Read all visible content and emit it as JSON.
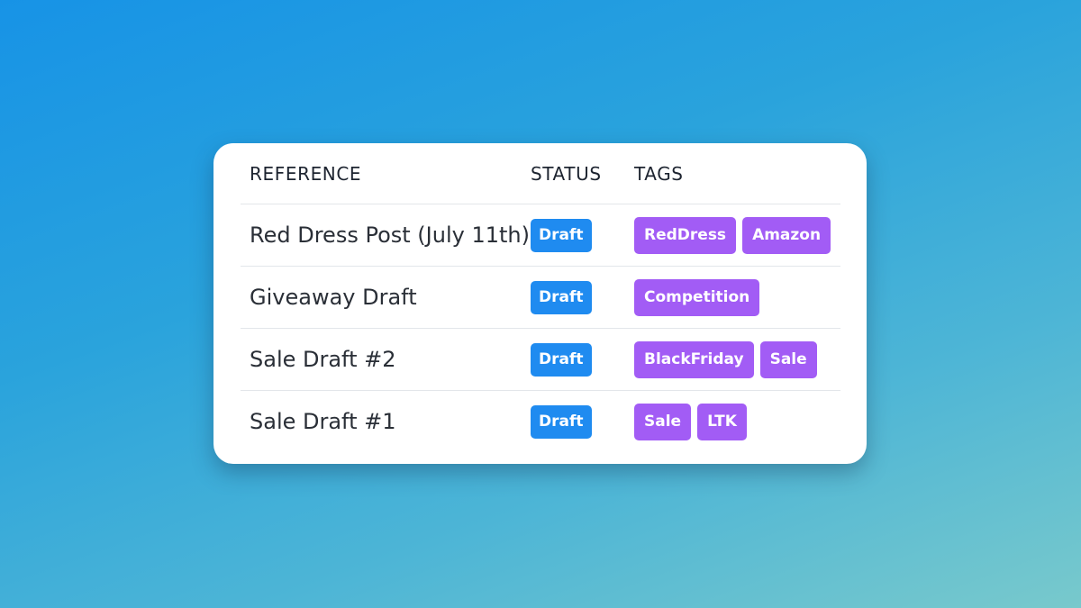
{
  "table": {
    "headers": {
      "reference": "REFERENCE",
      "status": "STATUS",
      "tags": "TAGS"
    },
    "rows": [
      {
        "reference": "Red Dress Post (July 11th)",
        "status": "Draft",
        "tags": [
          "RedDress",
          "Amazon"
        ]
      },
      {
        "reference": "Giveaway Draft",
        "status": "Draft",
        "tags": [
          "Competition"
        ]
      },
      {
        "reference": "Sale Draft #2",
        "status": "Draft",
        "tags": [
          "BlackFriday",
          "Sale"
        ]
      },
      {
        "reference": "Sale Draft #1",
        "status": "Draft",
        "tags": [
          "Sale",
          "LTK"
        ]
      }
    ]
  },
  "colors": {
    "status_badge": "#1f8bf0",
    "tag": "#a25cf5",
    "background_top": "#1793e6",
    "background_bottom": "#78c9cc"
  }
}
